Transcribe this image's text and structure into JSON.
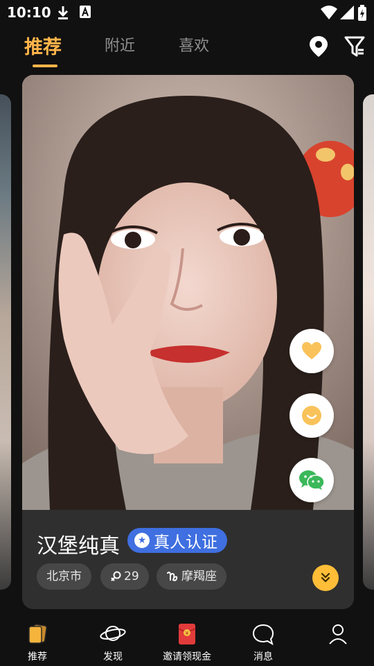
{
  "status_bar": {
    "time": "10:10"
  },
  "tabs": [
    {
      "label": "推荐",
      "active": true
    },
    {
      "label": "附近",
      "active": false
    },
    {
      "label": "喜欢",
      "active": false
    }
  ],
  "profile": {
    "name": "汉堡纯真",
    "verify_label": "真人认证",
    "tags": {
      "city": "北京市",
      "age": "29",
      "zodiac": "摩羯座"
    }
  },
  "nav": [
    {
      "label": "推荐",
      "icon": "cards-icon"
    },
    {
      "label": "发现",
      "icon": "planet-icon"
    },
    {
      "label": "邀请领现金",
      "icon": "red-envelope-icon"
    },
    {
      "label": "消息",
      "icon": "chat-bubble-icon"
    },
    {
      "label": "",
      "icon": "profile-icon"
    }
  ],
  "colors": {
    "accent": "#ffb54a",
    "verify_blue": "#3f6fe0",
    "heart": "#f9c25a",
    "wechat": "#3bb85a",
    "expand": "#ffbd38"
  }
}
